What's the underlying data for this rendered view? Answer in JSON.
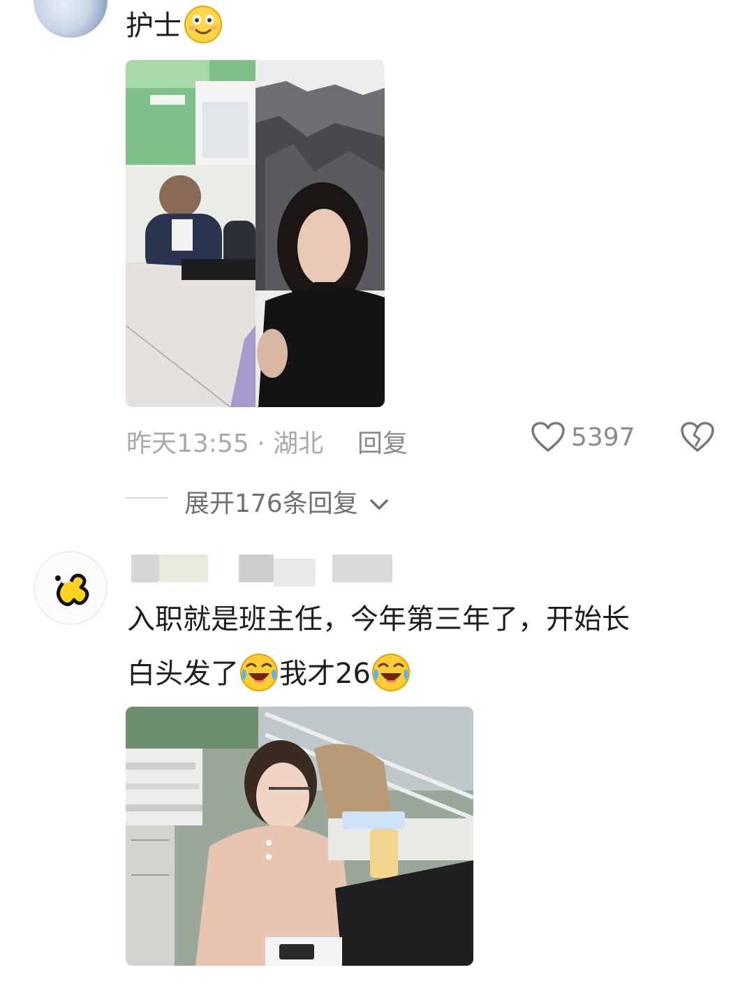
{
  "comments": [
    {
      "text": "护士",
      "emoji": "smile-emoji",
      "images": [
        "nurse-before-after-photo"
      ],
      "meta": {
        "time": "昨天13:55",
        "separator": "·",
        "location": "湖北",
        "reply_label": "回复",
        "likes": "5397"
      },
      "expand_replies": "展开176条回复"
    },
    {
      "username": "",
      "text_line1": "入职就是班主任，今年第三年了，开始长",
      "text_line2a": "白头发了",
      "text_line2b": "我才26",
      "emoji": "laugh-cry-emoji",
      "images": [
        "teacher-office-photo"
      ]
    }
  ],
  "icons": {
    "like": "heart-icon",
    "dislike": "broken-heart-icon",
    "expand": "chevron-down-icon"
  },
  "colors": {
    "background": "#ffffff",
    "text": "#1c1c1c",
    "meta": "#a8a8a8",
    "action": "#8a8a8a"
  }
}
